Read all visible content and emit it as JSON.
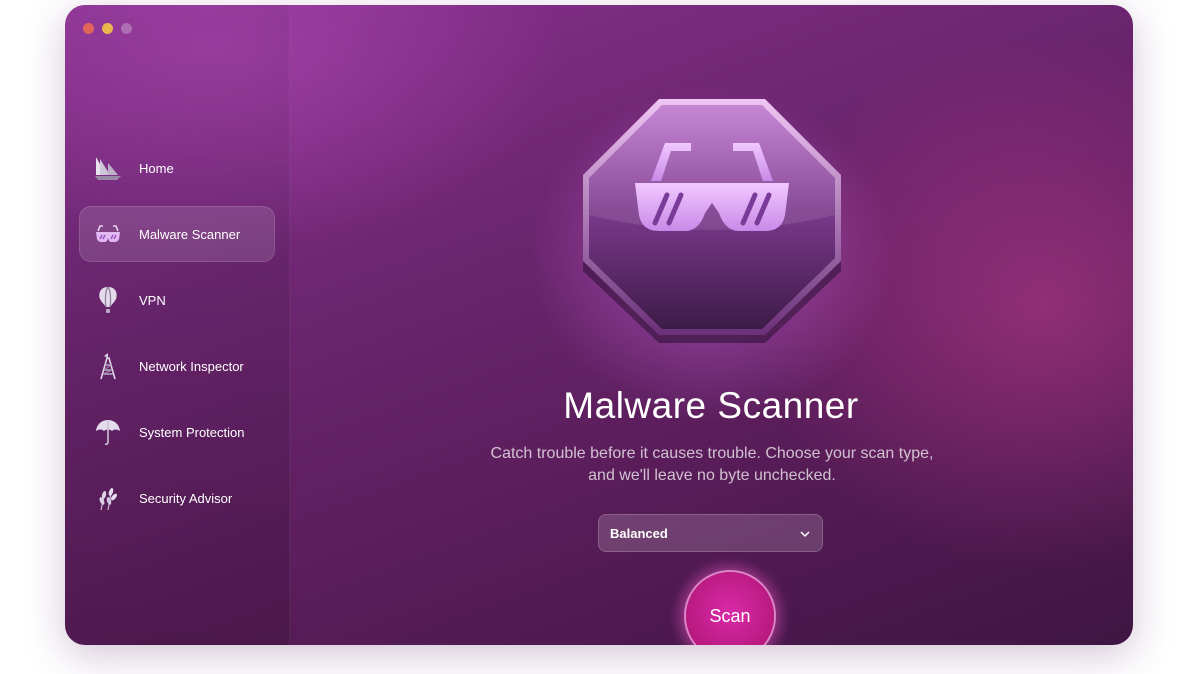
{
  "window": {
    "controls": [
      "close",
      "minimize",
      "zoom"
    ]
  },
  "sidebar": {
    "items": [
      {
        "label": "Home",
        "icon": "home-sails-icon",
        "active": false
      },
      {
        "label": "Malware Scanner",
        "icon": "sunglasses-icon",
        "active": true
      },
      {
        "label": "VPN",
        "icon": "balloon-icon",
        "active": false
      },
      {
        "label": "Network Inspector",
        "icon": "network-tower-icon",
        "active": false
      },
      {
        "label": "System Protection",
        "icon": "umbrella-icon",
        "active": false
      },
      {
        "label": "Security Advisor",
        "icon": "wheat-icon",
        "active": false
      }
    ]
  },
  "main": {
    "badge_icon": "sunglasses-badge-icon",
    "title": "Malware Scanner",
    "subtitle_line1": "Catch trouble before it causes trouble. Choose your scan type,",
    "subtitle_line2": "and we'll leave no byte unchecked.",
    "scan_type": {
      "selected": "Balanced",
      "icon": "chevron-down-icon"
    },
    "scan_button_label": "Scan"
  },
  "colors": {
    "accent": "#c21e8f",
    "background_start": "#8a3393",
    "background_end": "#3e1542"
  }
}
